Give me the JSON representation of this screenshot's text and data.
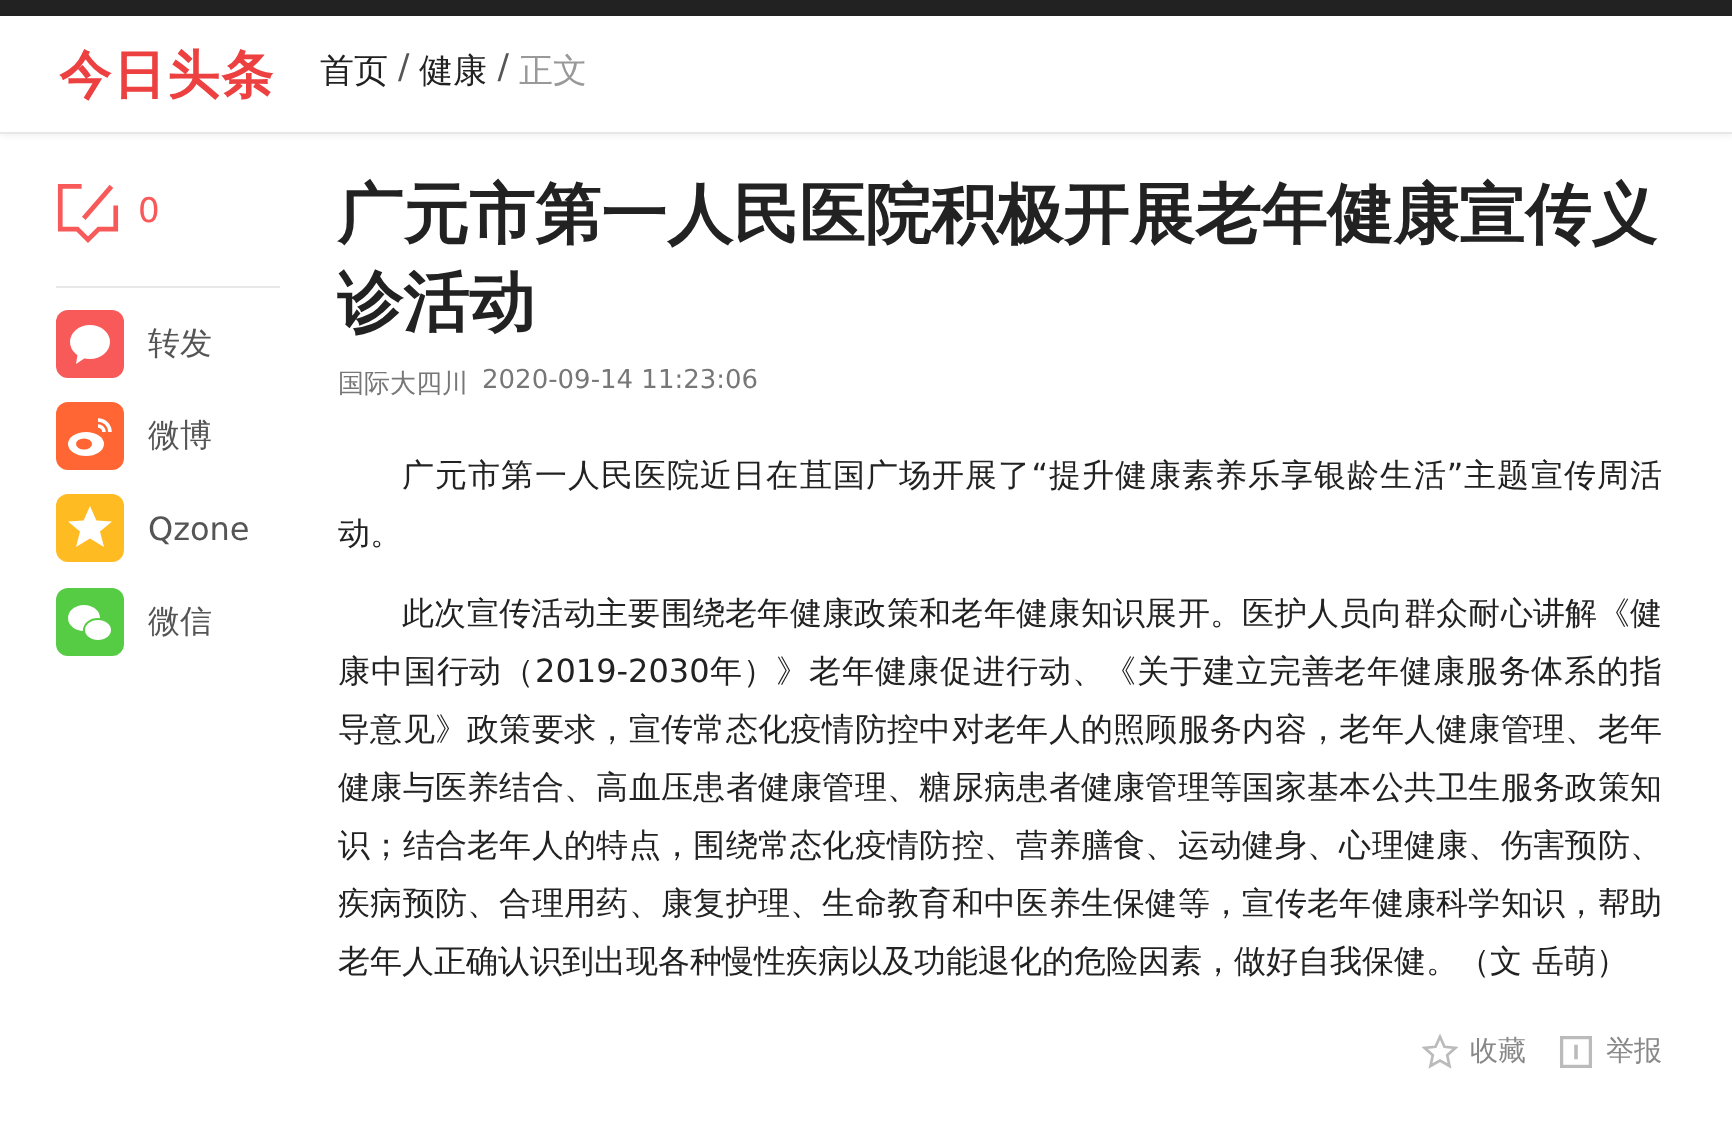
{
  "header": {
    "logo": "今日头条",
    "breadcrumb": [
      {
        "label": "首页",
        "current": false
      },
      {
        "label": "健康",
        "current": false
      },
      {
        "label": "正文",
        "current": true
      }
    ],
    "separator": "/"
  },
  "sidebar": {
    "comment_count": "0",
    "share": [
      {
        "kind": "repost",
        "label": "转发",
        "color": "#f85959"
      },
      {
        "kind": "weibo",
        "label": "微博",
        "color": "#ff6633"
      },
      {
        "kind": "qzone",
        "label": "Qzone",
        "color": "#ffbb22"
      },
      {
        "kind": "wechat",
        "label": "微信",
        "color": "#55cc44"
      }
    ]
  },
  "article": {
    "title": "广元市第一人民医院积极开展老年健康宣传义诊活动",
    "source": "国际大四川",
    "time": "2020-09-14 11:23:06",
    "paragraphs": [
      "广元市第一人民医院近日在苴国广场开展了“提升健康素养乐享银龄生活”主题宣传周活动。",
      "此次宣传活动主要围绕老年健康政策和老年健康知识展开。医护人员向群众耐心讲解《健康中国行动（2019-2030年）》老年健康促进行动、《关于建立完善老年健康服务体系的指导意见》政策要求，宣传常态化疫情防控中对老年人的照顾服务内容，老年人健康管理、老年健康与医养结合、高血压患者健康管理、糖尿病患者健康管理等国家基本公共卫生服务政策知识；结合老年人的特点，围绕常态化疫情防控、营养膳食、运动健身、心理健康、伤害预防、疾病预防、合理用药、康复护理、生命教育和中医养生保健等，宣传老年健康科学知识，帮助老年人正确认识到出现各种慢性疾病以及功能退化的危险因素，做好自我保健。（文 岳萌）"
    ],
    "actions": [
      {
        "kind": "favorite",
        "label": "收藏"
      },
      {
        "kind": "report",
        "label": "举报"
      }
    ]
  }
}
